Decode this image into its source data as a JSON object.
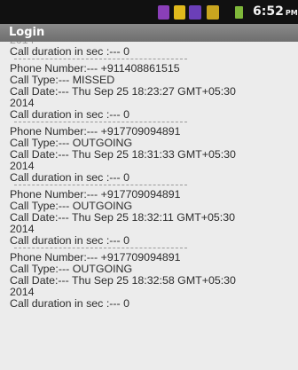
{
  "status_bar": {
    "time": "6:52",
    "ampm": "PM",
    "icons": [
      "notification-icon",
      "notification-icon",
      "signal-icon",
      "signal-icon",
      "battery-icon"
    ]
  },
  "title_bar": {
    "title": "Login"
  },
  "log": {
    "cut_text": "2014",
    "first_duration": "Call duration in sec :--- 0",
    "entries": [
      {
        "phone": "Phone Number:--- +911408861515",
        "type": "Call Type:--- MISSED",
        "date": "Call Date:--- Thu Sep 25 18:23:27 GMT+05:30",
        "year": "2014",
        "duration": "Call duration in sec :--- 0"
      },
      {
        "phone": "Phone Number:--- +917709094891",
        "type": "Call Type:--- OUTGOING",
        "date": "Call Date:--- Thu Sep 25 18:31:33 GMT+05:30",
        "year": "2014",
        "duration": "Call duration in sec :--- 0"
      },
      {
        "phone": "Phone Number:--- +917709094891",
        "type": "Call Type:--- OUTGOING",
        "date": "Call Date:--- Thu Sep 25 18:32:11 GMT+05:30",
        "year": "2014",
        "duration": "Call duration in sec :--- 0"
      },
      {
        "phone": "Phone Number:--- +917709094891",
        "type": "Call Type:--- OUTGOING",
        "date": "Call Date:--- Thu Sep 25 18:32:58 GMT+05:30",
        "year": "2014",
        "duration": "Call duration in sec :--- 0"
      }
    ]
  }
}
